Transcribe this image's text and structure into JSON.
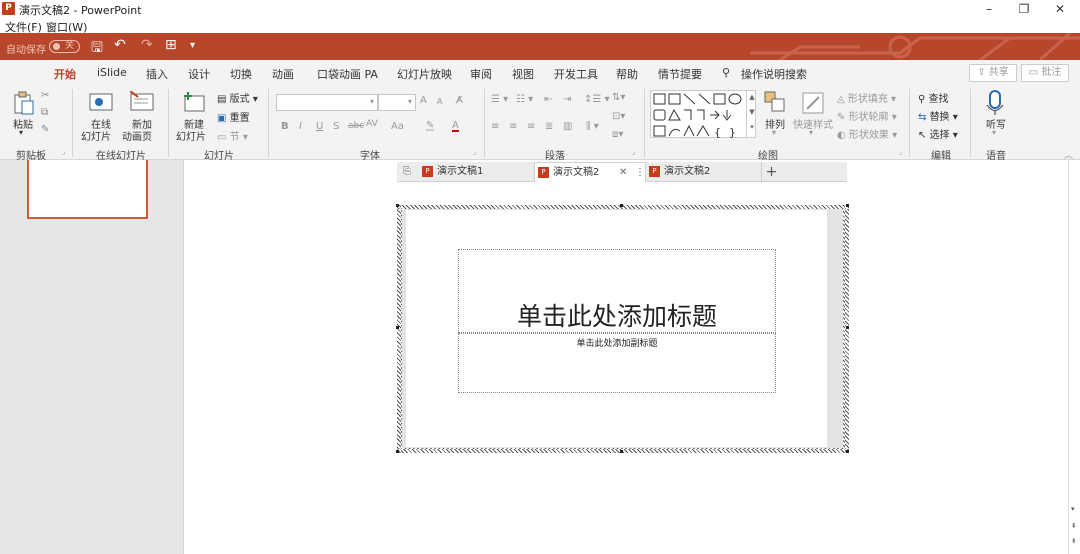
{
  "window": {
    "app_icon": "P",
    "title": "演示文稿2 - PowerPoint",
    "minimize": "–",
    "maximize": "❐",
    "close": "✕"
  },
  "menu": [
    "文件(F)",
    "窗口(W)"
  ],
  "qat": {
    "autosave_label": "自动保存",
    "autosave_state": "关",
    "save_icon": "🖫",
    "undo_icon": "↶",
    "redo_icon": "↷",
    "present_icon": "⊞",
    "more_icon": "▾"
  },
  "tabs": [
    "开始",
    "iSlide",
    "插入",
    "设计",
    "切换",
    "动画",
    "口袋动画 PA",
    "幻灯片放映",
    "审阅",
    "视图",
    "开发工具",
    "帮助",
    "情节提要",
    "操作说明搜索"
  ],
  "share": {
    "share": "共享",
    "comment": "批注"
  },
  "ribbon": {
    "clipboard": {
      "paste": "粘贴",
      "label": "剪贴板"
    },
    "online_slides": {
      "online": "在线",
      "online2": "幻灯片",
      "new_anim": "新加",
      "new_anim2": "动画页",
      "label": "在线幻灯片"
    },
    "slides": {
      "new": "新建",
      "new2": "幻灯片",
      "layout": "版式",
      "reset": "重置",
      "section": "节",
      "label": "幻灯片"
    },
    "font": {
      "label": "字体",
      "bold": "B",
      "italic": "I",
      "underline": "U",
      "shadow": "S",
      "strike": "abc",
      "spacing": "AV",
      "case": "Aa",
      "grow": "A",
      "shrink": "A"
    },
    "paragraph": {
      "label": "段落"
    },
    "drawing": {
      "arrange": "排列",
      "quick_styles": "快速样式",
      "fill": "形状填充",
      "outline": "形状轮廓",
      "effects": "形状效果",
      "label": "绘图"
    },
    "editing": {
      "find": "查找",
      "replace": "替换",
      "select": "选择",
      "label": "编辑"
    },
    "voice": {
      "dictate": "听写",
      "label": "语音"
    }
  },
  "doc_tabs": {
    "tab1": "演示文稿1",
    "tab2": "演示文稿2",
    "tab3": "演示文稿2",
    "add": "+"
  },
  "slide": {
    "title_placeholder": "单击此处添加标题",
    "subtitle_placeholder": "单击此处添加副标题"
  },
  "colors": {
    "accent": "#b7472a",
    "qat_bg": "#b7472a"
  }
}
